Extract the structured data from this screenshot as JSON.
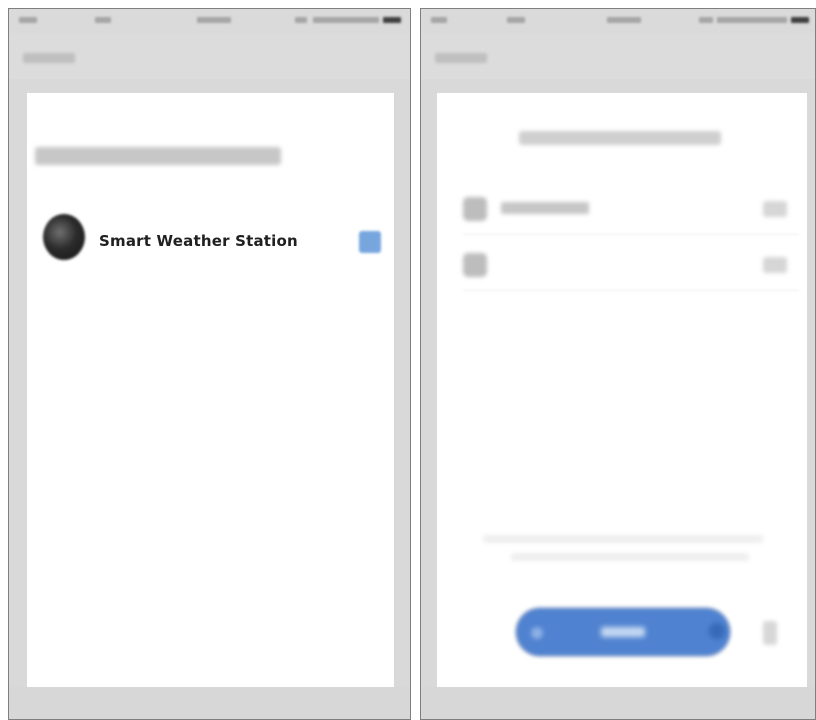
{
  "left_screen": {
    "device": {
      "label": "Smart Weather Station",
      "icon": "weather-station-icon",
      "add_icon": "add-device-icon"
    }
  },
  "colors": {
    "accent": "#4f82d0",
    "panel_background": "#ffffff",
    "frame_background": "#d9d9d9",
    "text_primary": "#202020"
  }
}
